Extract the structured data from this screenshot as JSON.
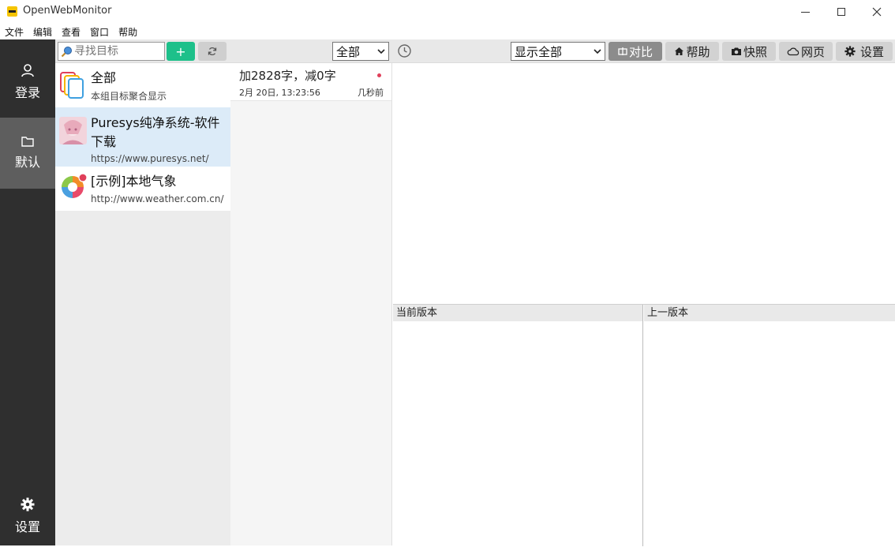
{
  "window": {
    "title": "OpenWebMonitor"
  },
  "menu": [
    "文件",
    "编辑",
    "查看",
    "窗口",
    "帮助"
  ],
  "nav": {
    "login": "登录",
    "default": "默认",
    "settings": "设置"
  },
  "toolbar": {
    "search_placeholder": "寻找目标",
    "add_label": "+",
    "filter_value": "全部",
    "display_value": "显示全部",
    "compare_label": "对比",
    "help_label": "帮助",
    "snapshot_label": "快照",
    "web_label": "网页",
    "settings_label": "设置"
  },
  "targets": [
    {
      "name": "全部",
      "sub": "本组目标聚合显示"
    },
    {
      "name": "Puresys纯净系统-软件下载",
      "sub": "https://www.puresys.net/"
    },
    {
      "name": "[示例]本地气象",
      "sub": "http://www.weather.com.cn/"
    }
  ],
  "changes": [
    {
      "title": "加2828字，减0字",
      "time": "2月 20日, 13:23:56",
      "ago": "几秒前"
    }
  ],
  "diff": {
    "current_label": "当前版本",
    "previous_label": "上一版本"
  },
  "colors": {
    "nav_bg": "#2f2f2f",
    "nav_active": "#5e5e5e",
    "add_green": "#1dc08a",
    "selected_row": "#dcebf8",
    "unread_dot": "#e0405a"
  }
}
